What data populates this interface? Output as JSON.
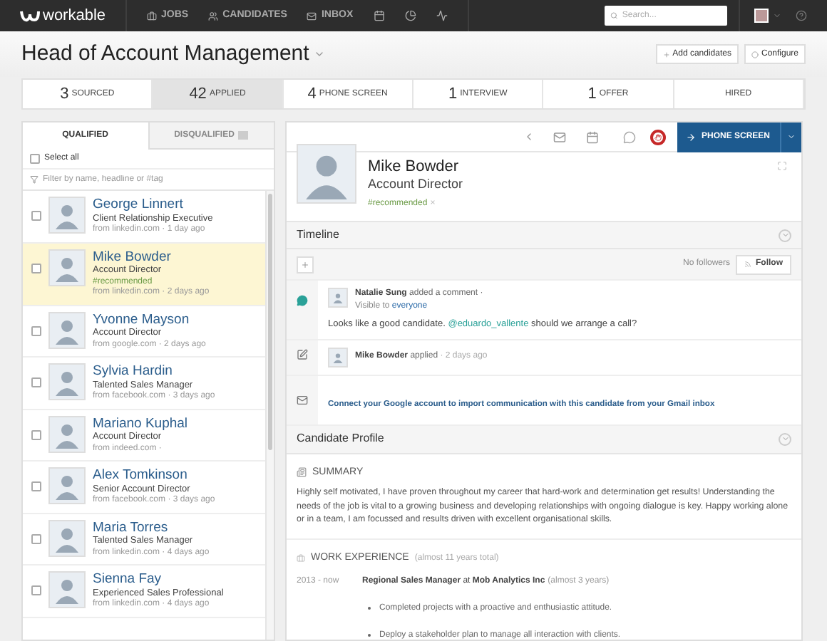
{
  "nav": {
    "logo": "workable",
    "links": [
      "JOBS",
      "CANDIDATES",
      "INBOX"
    ],
    "search": {
      "placeholder": "Search..."
    }
  },
  "header": {
    "title": "Head of Account Management",
    "buttons": [
      "Add candidates",
      "Configure"
    ]
  },
  "stages": [
    {
      "count": "3",
      "label": "SOURCED",
      "selected": false
    },
    {
      "count": "42",
      "label": "APPLIED",
      "selected": true
    },
    {
      "count": "4",
      "label": "PHONE SCREEN",
      "selected": false
    },
    {
      "count": "1",
      "label": "INTERVIEW",
      "selected": false
    },
    {
      "count": "1",
      "label": "OFFER",
      "selected": false
    },
    {
      "label": "HIRED",
      "selected": false
    }
  ],
  "candidate_list": {
    "tabs": [
      {
        "label": "QUALIFIED",
        "selected": true
      },
      {
        "label": "DISQUALIFIED",
        "selected": false
      }
    ],
    "select_all": {
      "label": "Select all",
      "checked": false
    },
    "filter": {
      "placeholder": "Filter by name, headline or #tag"
    },
    "items": [
      {
        "name": "George Linnert",
        "headline": "Client Relationship Executive",
        "source": "from linkedin.com · 1 day ago",
        "selected": false,
        "checked": false
      },
      {
        "name": "Mike Bowder",
        "headline": "Account Director",
        "tag": "#recommended",
        "source": "from linkedin.com · 2 days ago",
        "selected": true,
        "checked": false
      },
      {
        "name": "Yvonne Mayson",
        "headline": "Account Director",
        "source": "from google.com · 2 days ago",
        "selected": false,
        "checked": false
      },
      {
        "name": "Sylvia Hardin",
        "headline": "Talented Sales Manager",
        "source": "from facebook.com · 3 days ago",
        "selected": false,
        "checked": false
      },
      {
        "name": "Mariano Kuphal",
        "headline": "Account Director",
        "source": "from indeed.com ·",
        "selected": false,
        "checked": false
      },
      {
        "name": "Alex Tomkinson",
        "headline": "Senior Account Director",
        "source": "from facebook.com · 3 days ago",
        "selected": false,
        "checked": false
      },
      {
        "name": "Maria Torres",
        "headline": "Talented Sales Manager",
        "source": "from linkedin.com · 4 days ago",
        "selected": false,
        "checked": false
      },
      {
        "name": "Sienna Fay",
        "headline": "Experienced Sales Professional",
        "source": "from linkedin.com · 4 days ago",
        "selected": false,
        "checked": false
      }
    ]
  },
  "candidate": {
    "move_button": "PHONE SCREEN",
    "name": "Mike Bowder",
    "headline": "Account Director",
    "tag": "#recommended",
    "tag_remove": "×",
    "timeline": {
      "title": "Timeline",
      "followers": "No followers",
      "follow_button": "Follow",
      "events": [
        {
          "kind": "comment",
          "author": "Natalie Sung",
          "action": "added a comment ·",
          "visibility": "Visible to",
          "audience": "everyone",
          "text_before": "Looks like a good candidate.",
          "mention": "@eduardo_vallente",
          "text_after": "should we arrange a call?"
        },
        {
          "kind": "applied",
          "author": "Mike Bowder",
          "action": "applied",
          "time": "· 2 days ago"
        },
        {
          "kind": "email",
          "text": "Connect your Google account to import communication with this candidate from your Gmail inbox"
        }
      ]
    },
    "profile": {
      "title": "Candidate Profile",
      "summary_heading": "SUMMARY",
      "summary": "Highly self motivated, I have proven throughout my career that hard-work and determination get results! Understanding the needs of the job is vital to a growing business and developing relationships with ongoing dialogue is key. Happy working alone or in a team, I am focussed and results driven with excellent organisational skills.",
      "work_heading": "WORK EXPERIENCE",
      "work_total": "(almost 11 years total)",
      "jobs": [
        {
          "period": "2013 - now",
          "role": "**Regional Sales Manager** at **Mob Analytics Inc**",
          "duration": "(almost 3 years)",
          "bullets": [
            "Completed projects with a proactive and enthusiastic attitude.",
            "Deploy a stakeholder plan to manage all interaction with clients."
          ]
        }
      ]
    }
  }
}
